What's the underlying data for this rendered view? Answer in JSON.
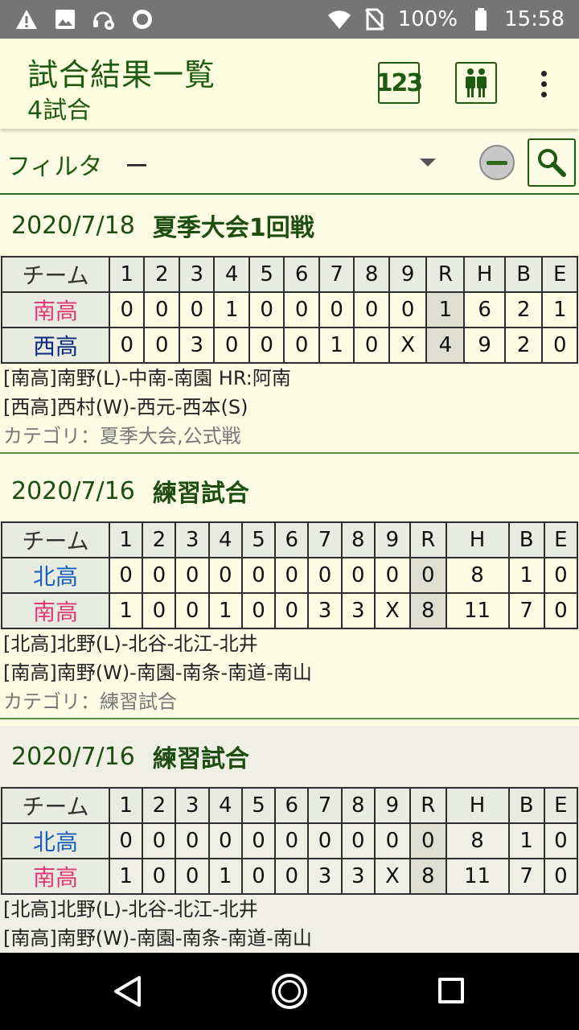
{
  "status_bar": {
    "battery": "100%",
    "time": "15:58",
    "icons": [
      "warning-icon",
      "image-icon",
      "headset-settings-icon",
      "circle-icon",
      "wifi-icon",
      "no-sim-icon",
      "battery-icon"
    ]
  },
  "app_bar": {
    "title": "試合結果一覧",
    "subtitle": "4試合",
    "score_button": "123",
    "team_button_icon": "people-icon",
    "more_icon": "more-vert-icon"
  },
  "filter": {
    "label": "フィルタ",
    "value": "ー"
  },
  "columns": [
    "チーム",
    "1",
    "2",
    "3",
    "4",
    "5",
    "6",
    "7",
    "8",
    "9",
    "R",
    "H",
    "B",
    "E"
  ],
  "games": [
    {
      "date": "2020/7/18",
      "title": "夏季大会1回戦",
      "rows": [
        {
          "team": "南高",
          "color": "#e03878",
          "cells": [
            "0",
            "0",
            "0",
            "1",
            "0",
            "0",
            "0",
            "0",
            "0",
            "1",
            "6",
            "2",
            "1"
          ]
        },
        {
          "team": "西高",
          "color": "#0c2a80",
          "cells": [
            "0",
            "0",
            "3",
            "0",
            "0",
            "0",
            "1",
            "0",
            "X",
            "4",
            "9",
            "2",
            "0"
          ]
        }
      ],
      "notes": [
        "[南高]南野(L)-中南-南園 HR:阿南",
        "[西高]西村(W)-西元-西本(S)"
      ],
      "category": "カテゴリ：夏季大会,公式戦"
    },
    {
      "date": "2020/7/16",
      "title": "練習試合",
      "rows": [
        {
          "team": "北高",
          "color": "#1a5fbf",
          "cells": [
            "0",
            "0",
            "0",
            "0",
            "0",
            "0",
            "0",
            "0",
            "0",
            "0",
            "8",
            "1",
            "0"
          ]
        },
        {
          "team": "南高",
          "color": "#e03878",
          "cells": [
            "1",
            "0",
            "0",
            "1",
            "0",
            "0",
            "3",
            "3",
            "X",
            "8",
            "11",
            "7",
            "0"
          ]
        }
      ],
      "notes": [
        "[北高]北野(L)-北谷-北江-北井",
        "[南高]南野(W)-南園-南条-南道-南山"
      ],
      "category": "カテゴリ：練習試合"
    },
    {
      "date": "2020/7/16",
      "title": "練習試合",
      "rows": [
        {
          "team": "北高",
          "color": "#1a5fbf",
          "cells": [
            "0",
            "0",
            "0",
            "0",
            "0",
            "0",
            "0",
            "0",
            "0",
            "0",
            "8",
            "1",
            "0"
          ]
        },
        {
          "team": "南高",
          "color": "#e03878",
          "cells": [
            "1",
            "0",
            "0",
            "1",
            "0",
            "0",
            "3",
            "3",
            "X",
            "8",
            "11",
            "7",
            "0"
          ]
        }
      ],
      "notes": [
        "[北高]北野(L)-北谷-北江-北井",
        "[南高]南野(W)-南園-南条-南道-南山"
      ],
      "category": ""
    }
  ],
  "nav_bar": {
    "icons": [
      "back-icon",
      "home-icon",
      "recent-apps-icon"
    ]
  }
}
